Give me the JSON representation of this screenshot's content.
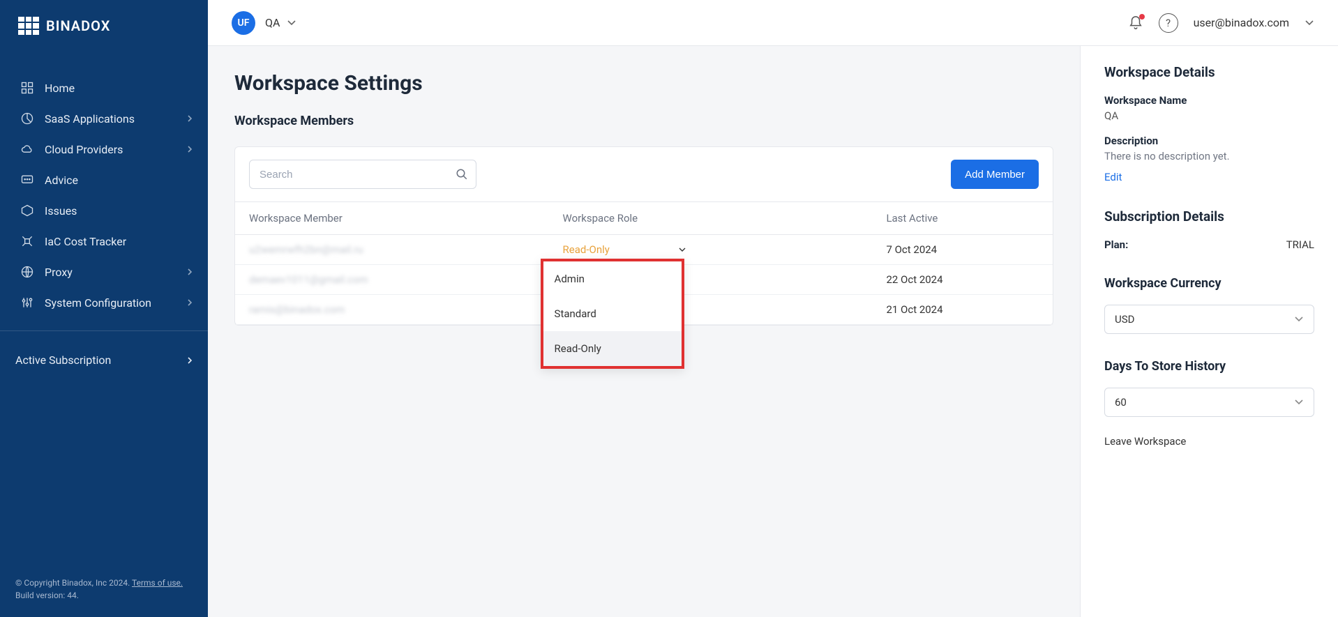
{
  "brand": "BINADOX",
  "sidebar": {
    "items": [
      {
        "label": "Home"
      },
      {
        "label": "SaaS Applications",
        "hasChildren": true
      },
      {
        "label": "Cloud Providers",
        "hasChildren": true
      },
      {
        "label": "Advice"
      },
      {
        "label": "Issues"
      },
      {
        "label": "IaC Cost Tracker"
      },
      {
        "label": "Proxy",
        "hasChildren": true
      },
      {
        "label": "System Configuration",
        "hasChildren": true
      }
    ],
    "activeSubscription": "Active Subscription",
    "copyright": "© Copyright Binadox, Inc 2024.",
    "termsLink": "Terms of use.",
    "buildVersion": "Build version: 44."
  },
  "topbar": {
    "avatarInitials": "UF",
    "workspace": "QA",
    "userEmail": "user@binadox.com"
  },
  "page": {
    "title": "Workspace Settings",
    "membersTitle": "Workspace Members",
    "searchPlaceholder": "Search",
    "addMemberLabel": "Add Member",
    "columns": {
      "member": "Workspace Member",
      "role": "Workspace Role",
      "lastActive": "Last Active"
    },
    "rows": [
      {
        "member": "u2wemrwfh2bn@mail.ru",
        "role": "Read-Only",
        "lastActive": "7 Oct 2024",
        "roleOpen": true
      },
      {
        "member": "demaev1011@gmail.com",
        "role": "",
        "lastActive": "22 Oct 2024"
      },
      {
        "member": "ramis@binadox.com",
        "role": "",
        "lastActive": "21 Oct 2024"
      }
    ],
    "roleOptions": [
      "Admin",
      "Standard",
      "Read-Only"
    ]
  },
  "details": {
    "heading": "Workspace Details",
    "nameLabel": "Workspace Name",
    "nameValue": "QA",
    "descLabel": "Description",
    "descValue": "There is no description yet.",
    "editLink": "Edit",
    "subHeading": "Subscription Details",
    "planLabel": "Plan:",
    "planValue": "TRIAL",
    "currencyHeading": "Workspace Currency",
    "currencyValue": "USD",
    "historyHeading": "Days To Store History",
    "historyValue": "60",
    "leaveLabel": "Leave Workspace"
  }
}
